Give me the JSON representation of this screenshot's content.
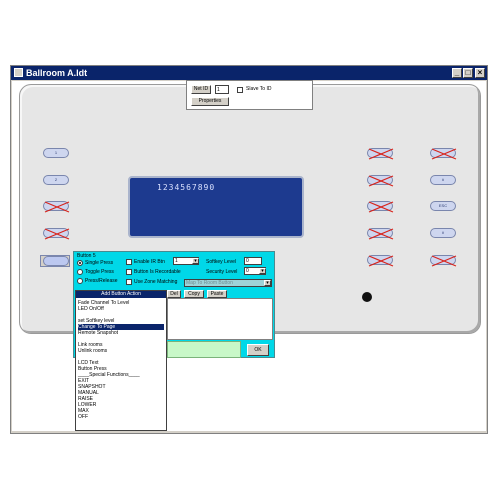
{
  "window": {
    "title": "Ballroom A.ldt",
    "min_glyph": "_",
    "max_glyph": "□",
    "close_glyph": "×"
  },
  "net": {
    "label": "Net ID",
    "value": "1",
    "slave_label": "Slave To ID",
    "properties_label": "Properties"
  },
  "keypad": {
    "left_buttons": [
      "1",
      "2",
      "",
      ""
    ],
    "right_buttons": [
      "",
      "",
      "",
      "",
      ""
    ],
    "far_right_buttons": [
      "",
      "∧",
      "ESC",
      "∨",
      ""
    ]
  },
  "lcd": {
    "text": "1234567890"
  },
  "button_props": {
    "title": "Button 5",
    "press_modes": [
      "Single Press",
      "Toggle Press",
      "Press/Release"
    ],
    "enable_ir": "Enable IR Btn",
    "ir_value": "1",
    "recordable": "Button Is Recordable",
    "zone_matching": "Use Zone Matching",
    "softkey_label": "Softkey Level",
    "softkey_value": "0",
    "security_label": "Security Level",
    "security_value": "0",
    "map_placeholder": "Map To Room Button",
    "del_label": "Del",
    "copy_label": "Copy",
    "paste_label": "Paste",
    "ok_label": "OK"
  },
  "actions": {
    "header": "Add Button Action",
    "items": [
      "Fade Channel To Level",
      "LED On/Off",
      "",
      "set Softkey level",
      "Change To Page",
      "Remote Snapshot",
      "",
      "Link rooms",
      "Unlink rooms",
      "",
      "LCD Text",
      "Button Press",
      "____Special Functions____",
      "EXIT",
      "SNAPSHOT",
      "MANUAL",
      "RAISE",
      "LOWER",
      "MAX",
      "OFF"
    ],
    "selected_index": 4
  },
  "colors": {
    "accent": "#0a246a",
    "lcd": "#1d3a8f",
    "props_panel": "#00d8e8",
    "disabled_x": "#d8241c"
  }
}
